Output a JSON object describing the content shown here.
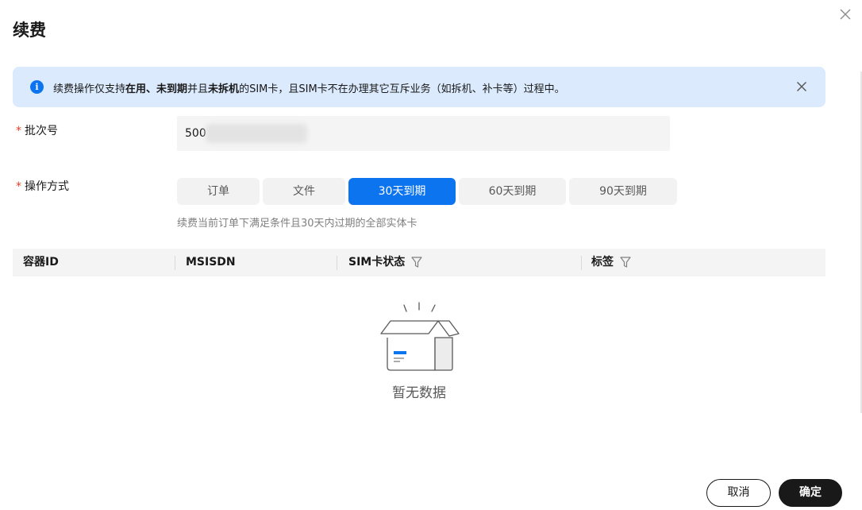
{
  "dialog": {
    "title": "续费"
  },
  "notice": {
    "part1": "续费操作仅支持",
    "bold1": "在用、未到期",
    "part2": "并且",
    "bold2": "未拆机",
    "part3": "的SIM卡，且SIM卡不在办理其它互斥业务（如拆机、补卡等）过程中。"
  },
  "form": {
    "batch": {
      "required_mark": "*",
      "label": "批次号",
      "value": "500"
    },
    "operation": {
      "required_mark": "*",
      "label": "操作方式",
      "options": [
        "订单",
        "文件",
        "30天到期",
        "60天到期",
        "90天到期"
      ],
      "selected": "30天到期",
      "hint": "续费当前订单下满足条件且30天内过期的全部实体卡"
    }
  },
  "table": {
    "columns": [
      "容器ID",
      "MSISDN",
      "SIM卡状态",
      "标签"
    ],
    "empty_text": "暂无数据"
  },
  "footer": {
    "cancel_label": "取消",
    "ok_label": "确定"
  },
  "colors": {
    "accent": "#0d74ef",
    "notice_bg": "#dbeafd",
    "required": "#e84026",
    "primary_button": "#191919"
  }
}
